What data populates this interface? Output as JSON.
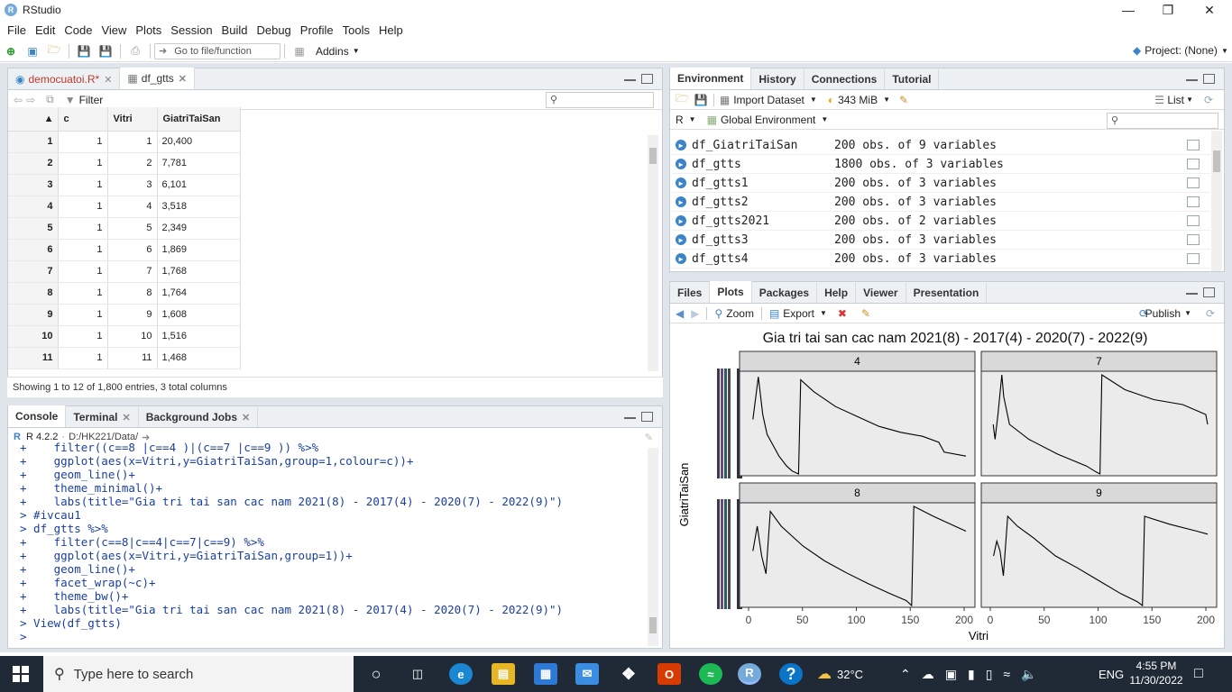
{
  "window": {
    "title": "RStudio"
  },
  "menu": [
    "File",
    "Edit",
    "Code",
    "View",
    "Plots",
    "Session",
    "Build",
    "Debug",
    "Profile",
    "Tools",
    "Help"
  ],
  "toolbar": {
    "goto_placeholder": "Go to file/function",
    "addins": "Addins",
    "project": "Project: (None)"
  },
  "source_pane": {
    "tabs": [
      {
        "label": "democuatoi.R*"
      },
      {
        "label": "df_gtts"
      }
    ],
    "filter_label": "Filter",
    "columns": [
      "c",
      "Vitri",
      "GiatriTaiSan"
    ],
    "rows": [
      [
        "1",
        "1",
        "1",
        "20,400"
      ],
      [
        "2",
        "1",
        "2",
        "7,781"
      ],
      [
        "3",
        "1",
        "3",
        "6,101"
      ],
      [
        "4",
        "1",
        "4",
        "3,518"
      ],
      [
        "5",
        "1",
        "5",
        "2,349"
      ],
      [
        "6",
        "1",
        "6",
        "1,869"
      ],
      [
        "7",
        "1",
        "7",
        "1,768"
      ],
      [
        "8",
        "1",
        "8",
        "1,764"
      ],
      [
        "9",
        "1",
        "9",
        "1,608"
      ],
      [
        "10",
        "1",
        "10",
        "1,516"
      ],
      [
        "11",
        "1",
        "11",
        "1,468"
      ]
    ],
    "status": "Showing 1 to 12 of 1,800 entries, 3 total columns"
  },
  "console_pane": {
    "tabs": [
      {
        "label": "Console"
      },
      {
        "label": "Terminal"
      },
      {
        "label": "Background Jobs"
      }
    ],
    "r_version": "R 4.2.2",
    "path": "D:/HK221/Data/",
    "lines": [
      {
        "t": "+    filter((c==8 |c==4 )|(c==7 |c==9 )) %>%",
        "cls": "c-blue"
      },
      {
        "t": "+    ggplot(aes(x=Vitri,y=GiatriTaiSan,group=1,colour=c))+",
        "cls": "c-blue"
      },
      {
        "t": "+    geom_line()+",
        "cls": "c-blue"
      },
      {
        "t": "+    theme_minimal()+",
        "cls": "c-blue"
      },
      {
        "t": "+    labs(title=\"Gia tri tai san cac nam 2021(8) - 2017(4) - 2020(7) - 2022(9)\")",
        "cls": "c-blue"
      },
      {
        "t": "> #ivcau1",
        "cls": "c-blue"
      },
      {
        "t": "> df_gtts %>%",
        "cls": "c-blue"
      },
      {
        "t": "+    filter(c==8|c==4|c==7|c==9) %>%",
        "cls": "c-blue"
      },
      {
        "t": "+    ggplot(aes(x=Vitri,y=GiatriTaiSan,group=1))+",
        "cls": "c-blue"
      },
      {
        "t": "+    geom_line()+",
        "cls": "c-blue"
      },
      {
        "t": "+    facet_wrap(~c)+",
        "cls": "c-blue"
      },
      {
        "t": "+    theme_bw()+",
        "cls": "c-blue"
      },
      {
        "t": "+    labs(title=\"Gia tri tai san cac nam 2021(8) - 2017(4) - 2020(7) - 2022(9)\")",
        "cls": "c-blue"
      },
      {
        "t": "> View(df_gtts)",
        "cls": "c-blue"
      },
      {
        "t": ">",
        "cls": "c-blue"
      }
    ]
  },
  "env_pane": {
    "tabs": [
      {
        "label": "Environment"
      },
      {
        "label": "History"
      },
      {
        "label": "Connections"
      },
      {
        "label": "Tutorial"
      }
    ],
    "import_label": "Import Dataset",
    "memory": "343 MiB",
    "view_mode": "List",
    "lang": "R",
    "scope": "Global Environment",
    "items": [
      {
        "name": "df_GiatriTaiSan",
        "value": "200 obs. of 9 variables"
      },
      {
        "name": "df_gtts",
        "value": "1800 obs. of 3 variables"
      },
      {
        "name": "df_gtts1",
        "value": "200 obs. of 3 variables"
      },
      {
        "name": "df_gtts2",
        "value": "200 obs. of 3 variables"
      },
      {
        "name": "df_gtts2021",
        "value": "200 obs. of 2 variables"
      },
      {
        "name": "df_gtts3",
        "value": "200 obs. of 3 variables"
      },
      {
        "name": "df_gtts4",
        "value": "200 obs. of 3 variables"
      }
    ]
  },
  "files_pane": {
    "tabs": [
      {
        "label": "Files"
      },
      {
        "label": "Plots"
      },
      {
        "label": "Packages"
      },
      {
        "label": "Help"
      },
      {
        "label": "Viewer"
      },
      {
        "label": "Presentation"
      }
    ],
    "zoom_label": "Zoom",
    "export_label": "Export",
    "publish_label": "Publish"
  },
  "chart_data": {
    "type": "line",
    "title": "Gia tri tai san cac nam 2021(8) - 2017(4) - 2020(7) - 2022(9)",
    "xlabel": "Vitri",
    "ylabel": "GiatriTaiSan",
    "xlim": [
      0,
      200
    ],
    "x_ticks": [
      "0",
      "50",
      "100",
      "150",
      "200"
    ],
    "facets": [
      "4",
      "7",
      "8",
      "9"
    ],
    "series": [
      {
        "name": "4",
        "shape": [
          [
            4,
            0.55
          ],
          [
            9,
            0.98
          ],
          [
            13,
            0.6
          ],
          [
            17,
            0.4
          ],
          [
            22,
            0.3
          ],
          [
            28,
            0.18
          ],
          [
            35,
            0.08
          ],
          [
            40,
            0.03
          ],
          [
            46,
            0.0
          ],
          [
            48,
            0.95
          ],
          [
            60,
            0.83
          ],
          [
            80,
            0.68
          ],
          [
            100,
            0.58
          ],
          [
            120,
            0.48
          ],
          [
            140,
            0.42
          ],
          [
            160,
            0.38
          ],
          [
            175,
            0.32
          ],
          [
            180,
            0.22
          ],
          [
            200,
            0.18
          ]
        ]
      },
      {
        "name": "7",
        "shape": [
          [
            3,
            0.5
          ],
          [
            5,
            0.35
          ],
          [
            8,
            0.6
          ],
          [
            12,
            1.0
          ],
          [
            14,
            0.78
          ],
          [
            20,
            0.5
          ],
          [
            40,
            0.35
          ],
          [
            70,
            0.2
          ],
          [
            100,
            0.08
          ],
          [
            110,
            0.02
          ],
          [
            114,
            0.0
          ],
          [
            116,
            1.0
          ],
          [
            140,
            0.85
          ],
          [
            170,
            0.75
          ],
          [
            200,
            0.7
          ],
          [
            224,
            0.6
          ],
          [
            226,
            0.5
          ]
        ]
      },
      {
        "name": "8",
        "shape": [
          [
            4,
            0.55
          ],
          [
            8,
            0.8
          ],
          [
            12,
            0.5
          ],
          [
            16,
            0.32
          ],
          [
            20,
            0.95
          ],
          [
            30,
            0.8
          ],
          [
            50,
            0.6
          ],
          [
            70,
            0.45
          ],
          [
            90,
            0.33
          ],
          [
            110,
            0.22
          ],
          [
            130,
            0.12
          ],
          [
            145,
            0.05
          ],
          [
            150,
            0.0
          ],
          [
            152,
            1.0
          ],
          [
            170,
            0.9
          ],
          [
            190,
            0.8
          ],
          [
            200,
            0.75
          ]
        ]
      },
      {
        "name": "9",
        "shape": [
          [
            3,
            0.5
          ],
          [
            6,
            0.65
          ],
          [
            9,
            0.55
          ],
          [
            12,
            0.3
          ],
          [
            16,
            0.9
          ],
          [
            25,
            0.8
          ],
          [
            40,
            0.68
          ],
          [
            60,
            0.5
          ],
          [
            80,
            0.38
          ],
          [
            100,
            0.25
          ],
          [
            120,
            0.12
          ],
          [
            135,
            0.04
          ],
          [
            140,
            0.0
          ],
          [
            142,
            0.9
          ],
          [
            165,
            0.82
          ],
          [
            190,
            0.75
          ],
          [
            200,
            0.72
          ]
        ]
      }
    ]
  },
  "taskbar": {
    "search_placeholder": "Type here to search",
    "weather": "32°C",
    "lang": "ENG",
    "time": "4:55 PM",
    "date": "11/30/2022"
  }
}
